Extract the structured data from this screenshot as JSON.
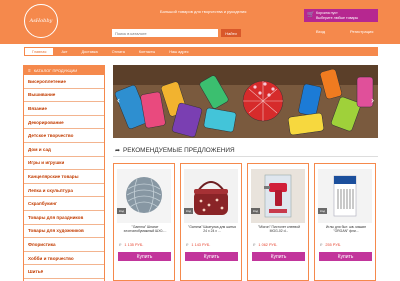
{
  "header": {
    "logo_text": "AsHobby",
    "tagline": "Большой товаров для творчества и рукоделия",
    "search_placeholder": "Поиск в каталоге",
    "search_button": "Найти",
    "cart_line1": "Корзина пуст",
    "cart_line2": "Выберите любые товары",
    "login": "Вход",
    "register": "Регистрация"
  },
  "nav": {
    "items": [
      "Главная",
      "Акт",
      "Доставка",
      "Оплата",
      "Контакты",
      "Наш адрес"
    ]
  },
  "sidebar": {
    "title": "КАТАЛОГ ПРОДУКЦИИ",
    "categories": [
      "Бисероплетение",
      "Вышивание",
      "Вязание",
      "Декорирование",
      "Детское творчество",
      "Дом и сад",
      "Игры и игрушки",
      "Канцелярские товары",
      "Лепка и скульптура",
      "Скрапбукинг",
      "Товары для праздников",
      "Товары для художников",
      "Флористика",
      "Хобби и творчество",
      "Шитьё"
    ]
  },
  "section": {
    "title": "РЕКОМЕНДУЕМЫЕ ПРЕДЛОЖЕНИЯ"
  },
  "products": [
    {
      "code": "Код",
      "name": "\"Gamma\" Шпагат хлопчатобумажный ШХ0-...",
      "price": "1 135 РУБ.",
      "buy": "Купить",
      "bg": "#bcc6cc"
    },
    {
      "code": "Код",
      "name": "\"Gamma\" Шкатулка для шитья 24 х 24 х ...",
      "price": "1 143 РУБ.",
      "buy": "Купить",
      "bg": "#f2f2f2"
    },
    {
      "code": "Код",
      "name": "\"Micron\" Пистолет клеевой MGG-02 d...",
      "price": "1 062 РУБ.",
      "buy": "Купить",
      "bg": "#e9e3dc"
    },
    {
      "code": "Код",
      "name": "Иглы для быт. шв. машин \"ORGAN\" фли...",
      "price": "255 РУБ.",
      "buy": "Купить",
      "bg": "#f3f3f3"
    }
  ],
  "colors": {
    "brand": "#f5894c",
    "accent": "#c2359b",
    "price": "#e7442f"
  }
}
